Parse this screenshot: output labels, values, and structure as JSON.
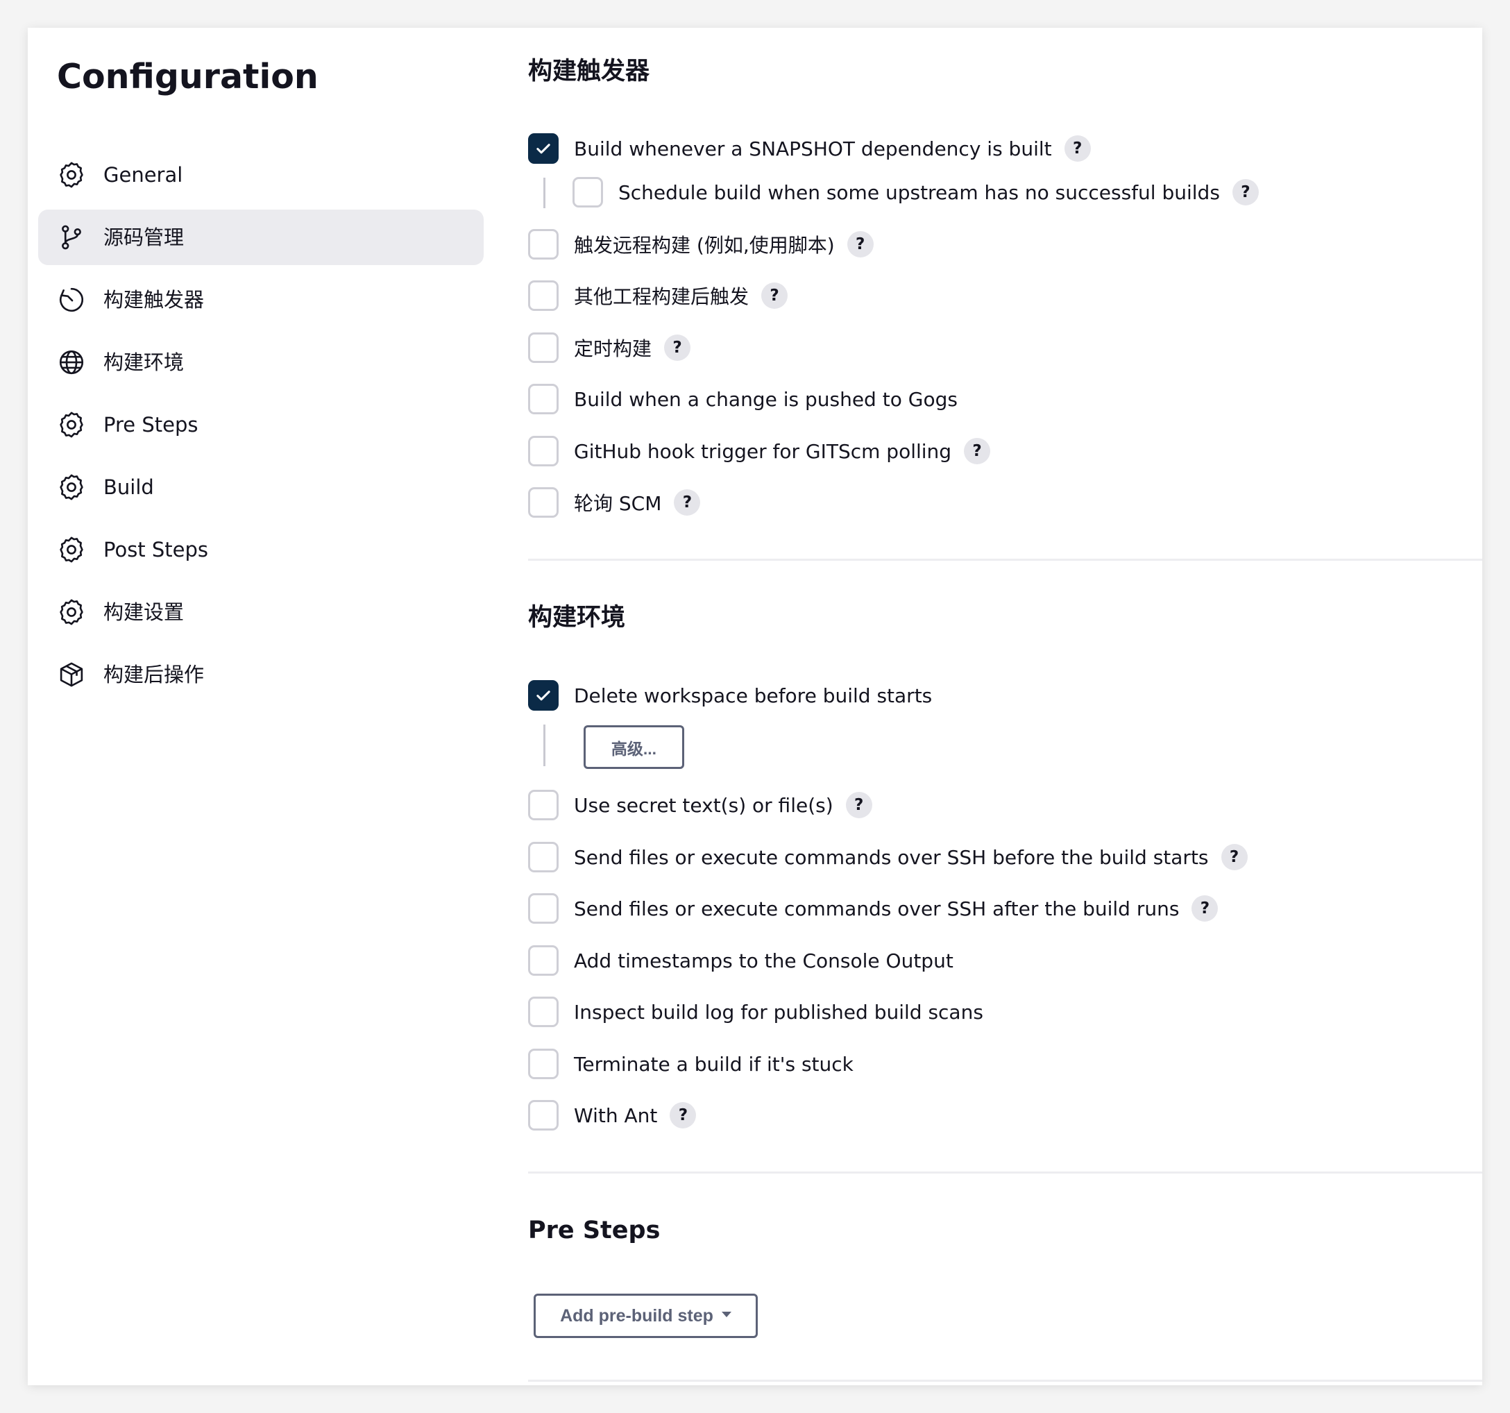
{
  "title": "Configuration",
  "sidebar": {
    "items": [
      {
        "label": "General",
        "icon": "gear-icon",
        "active": false
      },
      {
        "label": "源码管理",
        "icon": "branch-icon",
        "active": true
      },
      {
        "label": "构建触发器",
        "icon": "clock-icon",
        "active": false
      },
      {
        "label": "构建环境",
        "icon": "globe-icon",
        "active": false
      },
      {
        "label": "Pre Steps",
        "icon": "gear-icon",
        "active": false
      },
      {
        "label": "Build",
        "icon": "gear-icon",
        "active": false
      },
      {
        "label": "Post Steps",
        "icon": "gear-icon",
        "active": false
      },
      {
        "label": "构建设置",
        "icon": "gear-icon",
        "active": false
      },
      {
        "label": "构建后操作",
        "icon": "package-icon",
        "active": false
      }
    ]
  },
  "triggers": {
    "title": "构建触发器",
    "items": [
      {
        "label": "Build whenever a SNAPSHOT dependency is built",
        "checked": true,
        "help": "?"
      },
      {
        "label": "Schedule build when some upstream has no successful builds",
        "checked": false,
        "help": "?",
        "nested": true
      },
      {
        "label": "触发远程构建 (例如,使用脚本)",
        "checked": false,
        "help": "?"
      },
      {
        "label": "其他工程构建后触发",
        "checked": false,
        "help": "?"
      },
      {
        "label": "定时构建",
        "checked": false,
        "help": "?"
      },
      {
        "label": "Build when a change is pushed to Gogs",
        "checked": false
      },
      {
        "label": "GitHub hook trigger for GITScm polling",
        "checked": false,
        "help": "?"
      },
      {
        "label": "轮询 SCM",
        "checked": false,
        "help": "?"
      }
    ]
  },
  "environment": {
    "title": "构建环境",
    "advanced_label": "高级...",
    "items": [
      {
        "label": "Delete workspace before build starts",
        "checked": true
      },
      {
        "label": "Use secret text(s) or file(s)",
        "checked": false,
        "help": "?"
      },
      {
        "label": "Send files or execute commands over SSH before the build starts",
        "checked": false,
        "help": "?"
      },
      {
        "label": "Send files or execute commands over SSH after the build runs",
        "checked": false,
        "help": "?"
      },
      {
        "label": "Add timestamps to the Console Output",
        "checked": false
      },
      {
        "label": "Inspect build log for published build scans",
        "checked": false
      },
      {
        "label": "Terminate a build if it's stuck",
        "checked": false
      },
      {
        "label": "With Ant",
        "checked": false,
        "help": "?"
      }
    ]
  },
  "pre_steps": {
    "title": "Pre Steps",
    "add_button_label": "Add pre-build step"
  },
  "colors": {
    "checked_fill": "#0b2a47",
    "active_item_bg": "#ebebef",
    "button_outline": "#5c6277"
  }
}
